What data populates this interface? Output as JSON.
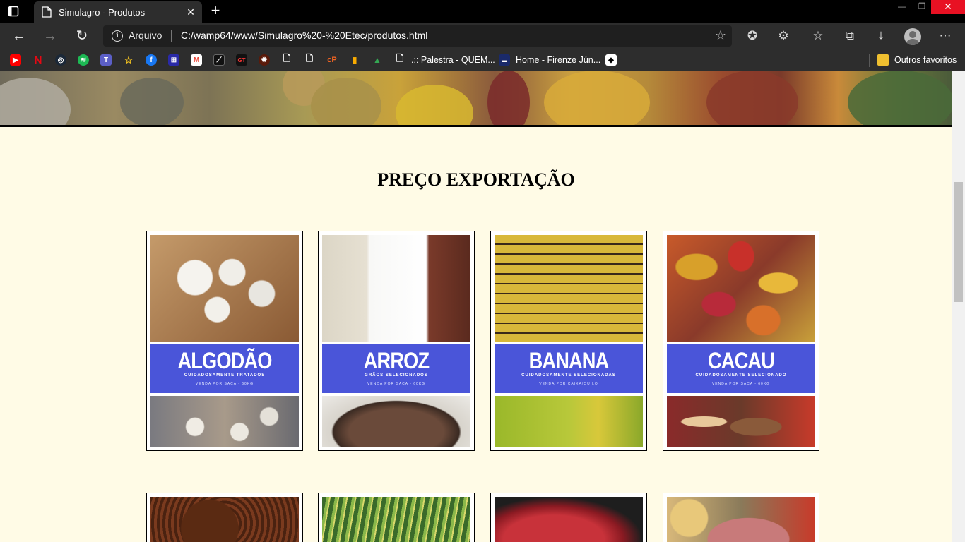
{
  "browser": {
    "tab_title": "Simulagro - Produtos",
    "address_scheme": "Arquivo",
    "address_url": "C:/wamp64/www/Simulagro%20-%20Etec/produtos.html",
    "bookmarks": [
      {
        "icon": "youtube-icon",
        "label": ""
      },
      {
        "icon": "netflix-icon",
        "label": ""
      },
      {
        "icon": "steam-icon",
        "label": ""
      },
      {
        "icon": "spotify-icon",
        "label": ""
      },
      {
        "icon": "teams-icon",
        "label": ""
      },
      {
        "icon": "star-icon",
        "label": ""
      },
      {
        "icon": "facebook-icon",
        "label": ""
      },
      {
        "icon": "app-icon",
        "label": ""
      },
      {
        "icon": "gmail-icon",
        "label": ""
      },
      {
        "icon": "app-icon",
        "label": ""
      },
      {
        "icon": "app-icon",
        "label": ""
      },
      {
        "icon": "app-icon",
        "label": ""
      },
      {
        "icon": "page-icon",
        "label": ""
      },
      {
        "icon": "page-icon",
        "label": ""
      },
      {
        "icon": "app-icon",
        "label": ""
      },
      {
        "icon": "analytics-icon",
        "label": ""
      },
      {
        "icon": "drive-icon",
        "label": ""
      },
      {
        "icon": "page-icon",
        "label": ".:: Palestra - QUEM..."
      },
      {
        "icon": "site-icon",
        "label": "Home - Firenze Jún..."
      },
      {
        "icon": "app-icon",
        "label": ""
      }
    ],
    "other_favorites": "Outros favoritos"
  },
  "page": {
    "section_title": "PREÇO EXPORTAÇÃO",
    "products": [
      {
        "name": "ALGODÃO",
        "subtitle": "CUIDADOSAMENTE TRATADOS",
        "unit": "VENDA POR SACA - 60KG",
        "top_color": "#b8865a",
        "bottom_color": "#a89a8a"
      },
      {
        "name": "ARROZ",
        "subtitle": "GRÃOS SELECIONADOS",
        "unit": "VENDA POR SACA - 60KG",
        "top_color": "#e8e4dc",
        "bottom_color": "#6a4a3a"
      },
      {
        "name": "BANANA",
        "subtitle": "CUIDADOSAMENTE SELECIONADAS",
        "unit": "VENDA POR CAIXA/QUILO",
        "top_color": "#a6b83a",
        "bottom_color": "#9ab82a"
      },
      {
        "name": "CACAU",
        "subtitle": "CUIDADOSAMENTE SELECIONADO",
        "unit": "VENDA POR SACA - 60KG",
        "top_color": "#c85a2a",
        "bottom_color": "#8a3a2a"
      }
    ],
    "products_row2": [
      {
        "top_color": "#6a3a22"
      },
      {
        "top_color": "#5a8a3a"
      },
      {
        "top_color": "#a8323a"
      },
      {
        "top_color": "#b89a6a"
      }
    ]
  }
}
